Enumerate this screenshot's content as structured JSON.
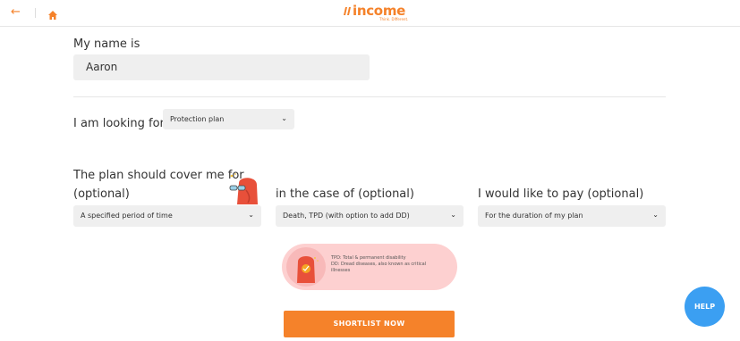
{
  "header": {
    "back_icon": "arrow-left-icon",
    "home_icon": "home-icon",
    "logo_text": "income",
    "logo_tagline": "Think. Different."
  },
  "form": {
    "name_label": "My name is",
    "name_value": "Aaron",
    "looking_label": "I am looking for a",
    "looking_value": "Protection plan",
    "cover_label_line1": "The plan should cover me for",
    "cover_label_line2": "(optional)",
    "cover_value": "A specified period of time",
    "case_label": "in the case of (optional)",
    "case_value": "Death, TPD (with option to add DD)",
    "pay_label": "I would like to pay (optional)",
    "pay_value": "For the duration of my plan"
  },
  "info": {
    "line1": "TPD: Total & permanent disability",
    "line2": "DD: Dread diseases, also known as critical",
    "line3": "illnesses"
  },
  "cta_label": "SHORTLIST NOW",
  "help_label": "HELP",
  "colors": {
    "brand": "#f5822a",
    "help": "#3b9ff2",
    "pill": "#fdd0d0",
    "field_bg": "#efefef"
  }
}
